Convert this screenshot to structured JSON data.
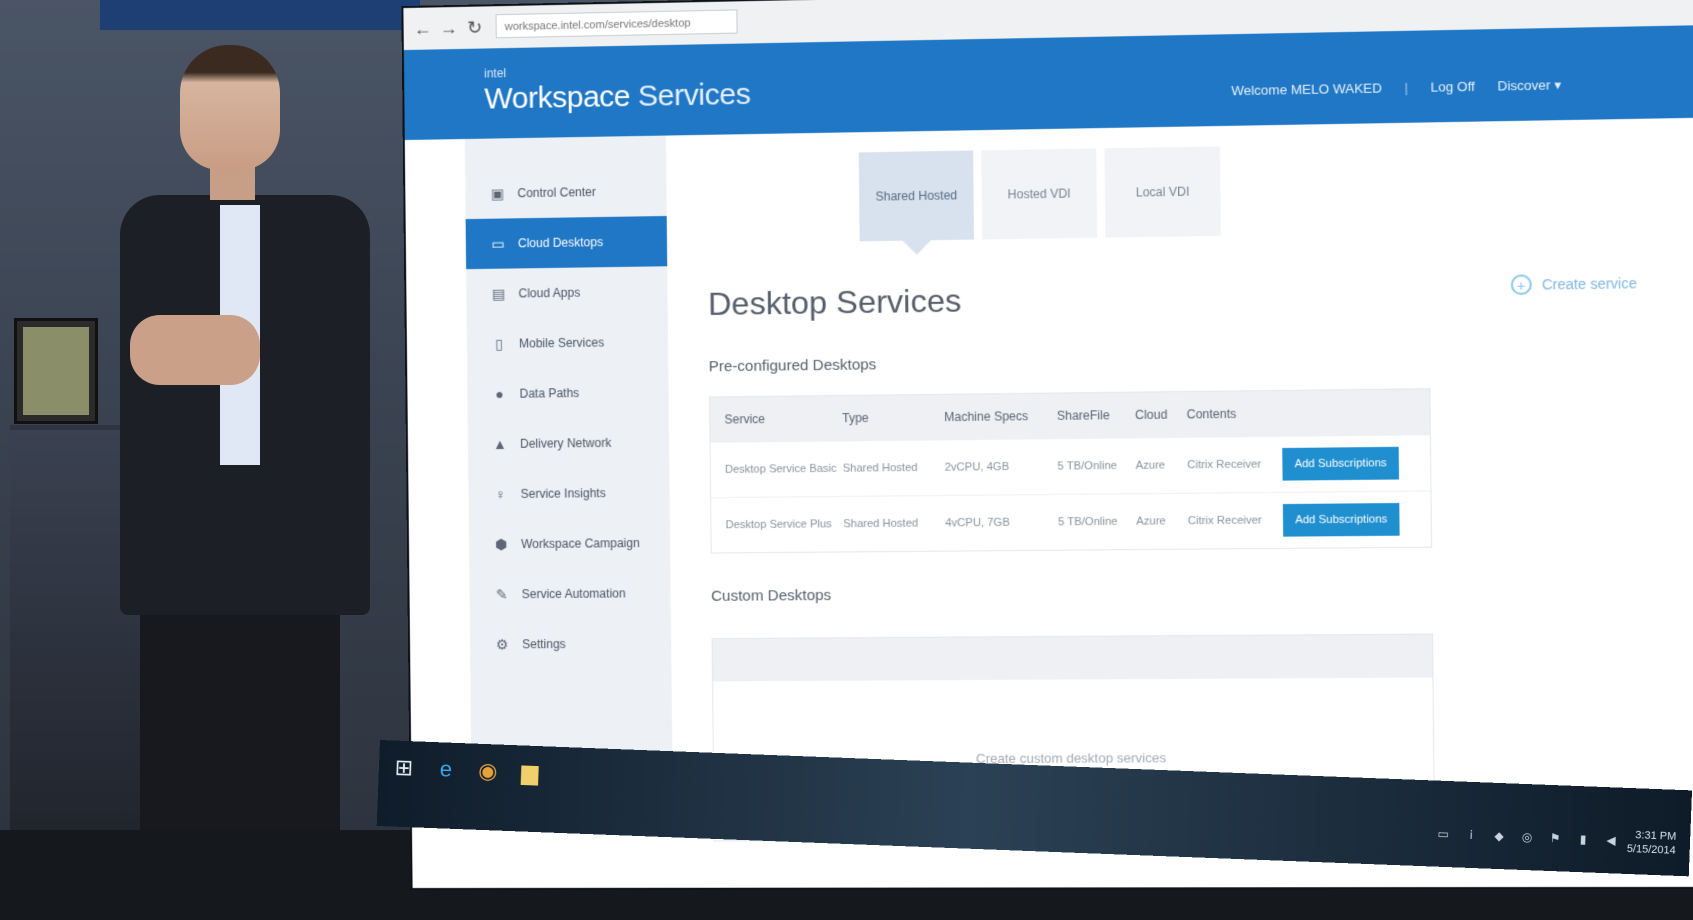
{
  "browser": {
    "url": "workspace.intel.com/services/desktop"
  },
  "header": {
    "brand_small": "intel",
    "brand_main": "Workspace",
    "brand_sub": "Services",
    "welcome": "Welcome MELO WAKED",
    "separator": "|",
    "logout": "Log Off",
    "account": "Discover ▾"
  },
  "sidebar": {
    "items": [
      {
        "label": "Control Center",
        "icon": "clipboard-icon"
      },
      {
        "label": "Cloud Desktops",
        "icon": "monitor-icon"
      },
      {
        "label": "Cloud Apps",
        "icon": "document-icon"
      },
      {
        "label": "Mobile Services",
        "icon": "phone-icon"
      },
      {
        "label": "Data Paths",
        "icon": "folder-icon"
      },
      {
        "label": "Delivery Network",
        "icon": "network-icon"
      },
      {
        "label": "Service Insights",
        "icon": "lightbulb-icon"
      },
      {
        "label": "Workspace Campaign",
        "icon": "shield-icon"
      },
      {
        "label": "Service Automation",
        "icon": "gear-icon"
      },
      {
        "label": "Settings",
        "icon": "settings-icon"
      }
    ]
  },
  "tabs": [
    {
      "label": "Shared Hosted"
    },
    {
      "label": "Hosted VDI"
    },
    {
      "label": "Local VDI"
    }
  ],
  "main": {
    "title": "Desktop Services",
    "create_label": "Create service",
    "preconfigured_title": "Pre-configured Desktops",
    "custom_title": "Custom Desktops",
    "custom_empty": "Create custom desktop services"
  },
  "table": {
    "headers": [
      "Service",
      "Type",
      "Machine Specs",
      "ShareFile",
      "Cloud",
      "Contents",
      ""
    ],
    "rows": [
      [
        "Desktop Service Basic",
        "Shared Hosted",
        "2vCPU, 4GB",
        "5 TB/Online",
        "Azure",
        "Citrix Receiver",
        "Add Subscriptions"
      ],
      [
        "Desktop Service Plus",
        "Shared Hosted",
        "4vCPU, 7GB",
        "5 TB/Online",
        "Azure",
        "Citrix Receiver",
        "Add Subscriptions"
      ]
    ]
  },
  "taskbar": {
    "clock_time": "3:31 PM",
    "clock_date": "5/15/2014"
  },
  "colors": {
    "accent": "#1f77c5",
    "button": "#1f8fd0"
  }
}
